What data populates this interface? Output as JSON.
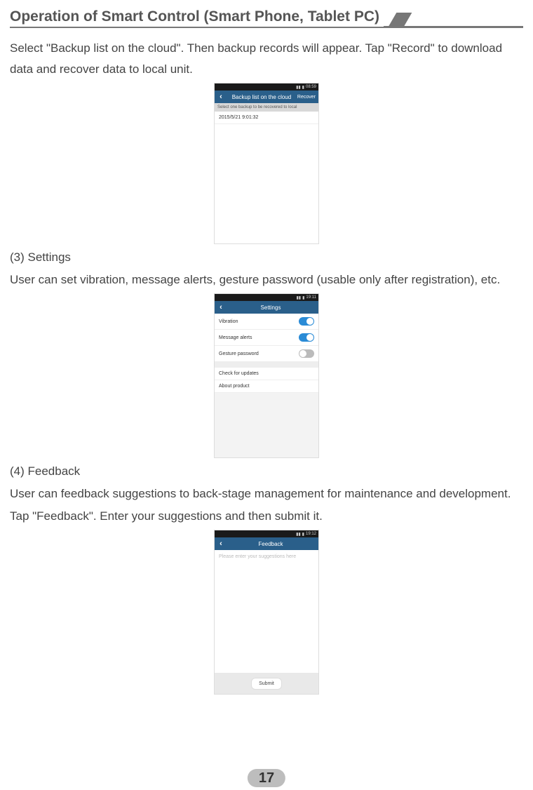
{
  "header": {
    "title": "Operation of Smart Control (Smart Phone, Tablet PC)"
  },
  "body": {
    "p1": "Select \"Backup list on the cloud\". Then backup records will appear. Tap \"Record\" to download data and recover data to local unit.",
    "s3_title": "(3) Settings",
    "s3_body": "User can set vibration, message alerts, gesture password (usable only after registration), etc.",
    "s4_title": "(4) Feedback",
    "s4_body": "User can feedback suggestions to back-stage management for maintenance and development.",
    "s4_body2": "Tap \"Feedback\". Enter your suggestions and then submit it."
  },
  "phone_backup": {
    "status_time": "08:59",
    "back": "‹",
    "title": "Backup list on the cloud",
    "action": "Recover",
    "subhead": "Select one backup to be recovered to local",
    "record": "2015/5/21 9:01:32"
  },
  "phone_settings": {
    "status_time": "19:11",
    "back": "‹",
    "title": "Settings",
    "rows": {
      "vibration": "Vibration",
      "message_alerts": "Message alerts",
      "gesture_password": "Gesture password",
      "check_updates": "Check for updates",
      "about_product": "About product"
    }
  },
  "phone_feedback": {
    "status_time": "19:12",
    "back": "‹",
    "title": "Feedback",
    "placeholder": "Please enter your suggestions here",
    "submit": "Submit"
  },
  "page_number": "17"
}
